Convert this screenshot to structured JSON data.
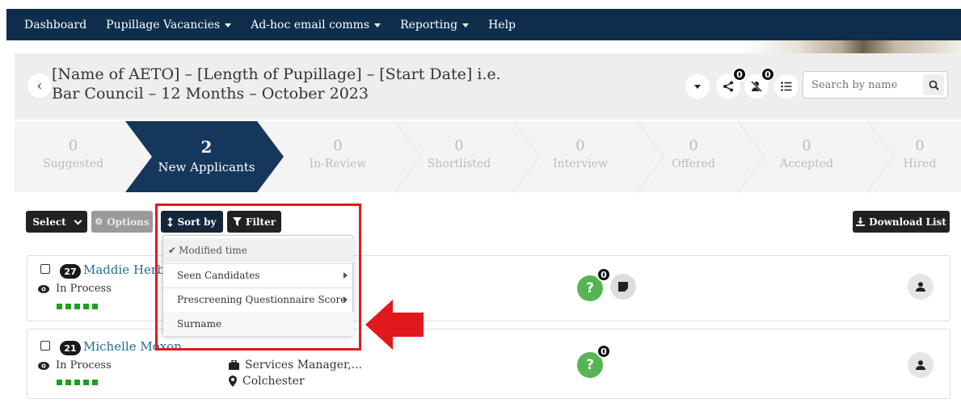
{
  "nav": {
    "items": [
      {
        "label": "Dashboard",
        "has_caret": false
      },
      {
        "label": "Pupillage Vacancies",
        "has_caret": true
      },
      {
        "label": "Ad-hoc email comms",
        "has_caret": true
      },
      {
        "label": "Reporting",
        "has_caret": true
      },
      {
        "label": "Help",
        "has_caret": false
      }
    ]
  },
  "header": {
    "title": "[Name of AETO] – [Length of Pupillage] – [Start Date] i.e. Bar Council – 12 Months – October 2023",
    "share_badge": "0",
    "unassign_badge": "0",
    "search_placeholder": "Search by name"
  },
  "pipeline": [
    {
      "count": "0",
      "label": "Suggested"
    },
    {
      "count": "2",
      "label": "New Applicants",
      "active": true
    },
    {
      "count": "0",
      "label": "In-Review"
    },
    {
      "count": "0",
      "label": "Shortlisted"
    },
    {
      "count": "0",
      "label": "Interview"
    },
    {
      "count": "0",
      "label": "Offered"
    },
    {
      "count": "0",
      "label": "Accepted"
    },
    {
      "count": "0",
      "label": "Hired"
    }
  ],
  "toolbar": {
    "select_label": "Select",
    "options_label": "Options",
    "sort_label": "Sort by",
    "filter_label": "Filter",
    "download_label": "Download List"
  },
  "sort_menu": {
    "items": [
      {
        "label": "Modified time",
        "selected": true,
        "submenu": false
      },
      {
        "label": "Seen Candidates",
        "selected": false,
        "submenu": true
      },
      {
        "label": "Prescreening Questionnaire Score",
        "selected": false,
        "submenu": true
      },
      {
        "label": "Surname",
        "selected": false,
        "submenu": false
      }
    ]
  },
  "candidates": [
    {
      "score": "27",
      "name": "Maddie Herbe",
      "status": "In Process",
      "question_badge": "0",
      "job": "",
      "location": ""
    },
    {
      "score": "21",
      "name": "Michelle Moxon",
      "status": "In Process",
      "question_badge": "0",
      "job": "Services Manager,...",
      "location": "Colchester"
    }
  ],
  "colors": {
    "nav_bg": "#0f2e4d",
    "active_stage": "#15375c",
    "link": "#1f6e98",
    "success": "#55b555",
    "annotation": "#e2191c"
  }
}
